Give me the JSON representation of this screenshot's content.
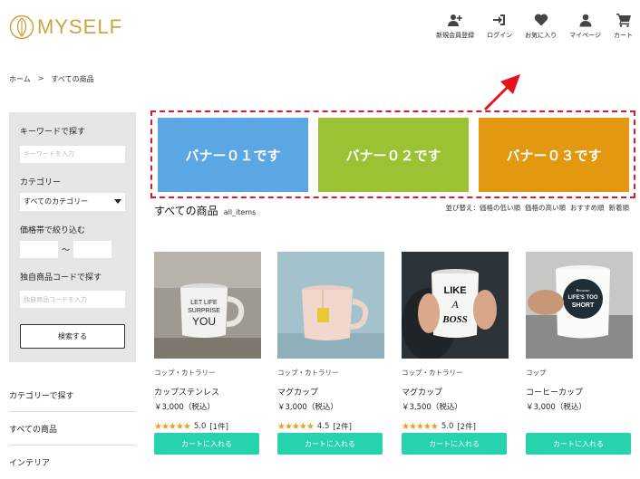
{
  "header": {
    "logo_text": "MYSELF",
    "nav": [
      {
        "label": "新規会員登録",
        "icon": "user-plus-icon"
      },
      {
        "label": "ログイン",
        "icon": "login-icon"
      },
      {
        "label": "お気に入り",
        "icon": "heart-icon"
      },
      {
        "label": "マイページ",
        "icon": "user-icon"
      },
      {
        "label": "カート",
        "icon": "cart-icon"
      }
    ]
  },
  "breadcrumb": {
    "home": "ホーム",
    "sep": ">",
    "current": "すべての商品"
  },
  "sidebar": {
    "keyword_label": "キーワードで探す",
    "keyword_placeholder": "キーワードを入力",
    "category_label": "カテゴリー",
    "category_value": "すべてのカテゴリー",
    "price_label": "価格帯で絞り込む",
    "price_sep": "〜",
    "code_label": "独自商品コードで探す",
    "code_placeholder": "独自商品コードを入力",
    "search_button": "検索する",
    "links": [
      "カテゴリーで探す",
      "すべての商品",
      "インテリア"
    ]
  },
  "banners": [
    {
      "label": "バナー０１です",
      "color": "#5aa7e3"
    },
    {
      "label": "バナー０２です",
      "color": "#9ac234"
    },
    {
      "label": "バナー０３です",
      "color": "#e29811"
    }
  ],
  "section": {
    "title": "すべての商品",
    "subtitle": "all_items",
    "sort_prefix": "並び替え：",
    "sort_options": [
      "価格の低い順",
      "価格の高い順",
      "おすすめ順",
      "新着順"
    ]
  },
  "products": [
    {
      "category": "コップ・カトラリー",
      "name": "カップステンレス",
      "price": "￥3,000（税込）",
      "stars": "★★★★★",
      "rating": "5.0",
      "reviews": "[1件]",
      "cart": "カートに入れる",
      "mug_text": "LET LIFE SURPRISE YOU"
    },
    {
      "category": "コップ・カトラリー",
      "name": "マグカップ",
      "price": "￥3,000（税込）",
      "stars": "★★★★★",
      "rating": "4.5",
      "reviews": "[2件]",
      "cart": "カートに入れる"
    },
    {
      "category": "コップ・カトラリー",
      "name": "マグカップ",
      "price": "￥3,500（税込）",
      "stars": "★★★★★",
      "rating": "5.0",
      "reviews": "[2件]",
      "cart": "カートに入れる",
      "mug_text": "LIKE A BOSS"
    },
    {
      "category": "コップ",
      "name": "コーヒーカップ",
      "price": "￥3,000（税込）",
      "cart": "カートに入れる",
      "mug_text": "LIFE'S TOO SHORT"
    }
  ],
  "colors": {
    "accent": "#27d3ac",
    "logo": "#c9a43f",
    "highlight": "#d9192f",
    "star": "#f0a020"
  }
}
